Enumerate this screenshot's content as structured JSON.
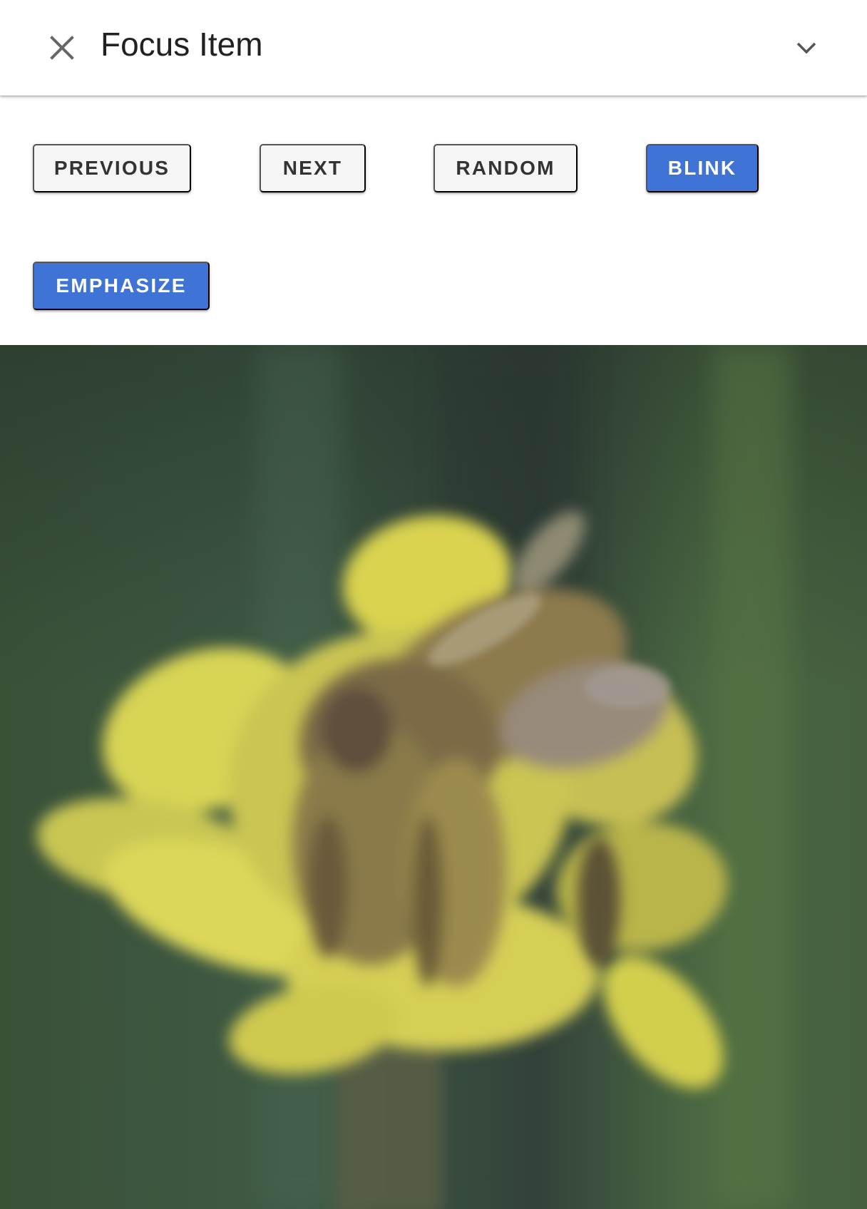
{
  "header": {
    "close_icon": "close-icon",
    "title": "Focus Item",
    "expand_icon": "chevron-down-icon"
  },
  "controls": {
    "previous_label": "PREVIOUS",
    "next_label": "NEXT",
    "random_label": "RANDOM",
    "blink_label": "BLINK",
    "emphasize_label": "EMPHASIZE"
  },
  "colors": {
    "primary_button": "#3f73d6",
    "default_button": "#f5f5f5",
    "title_text": "#212121",
    "icon": "#666666"
  },
  "image": {
    "subject": "bee-on-yellow-flower-photo"
  }
}
